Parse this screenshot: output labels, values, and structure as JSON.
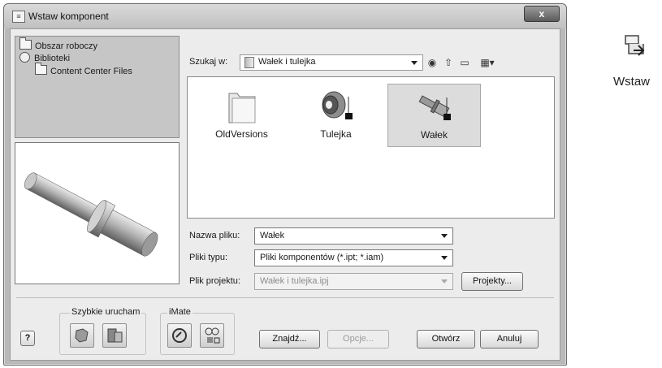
{
  "dialog": {
    "title": "Wstaw komponent",
    "close_label": "x"
  },
  "library_tree": {
    "items": [
      {
        "label": "Obszar roboczy",
        "icon": "workspace-folder-icon"
      },
      {
        "label": "Biblioteki",
        "icon": "libraries-icon"
      },
      {
        "label": "Content Center Files",
        "icon": "folder-icon"
      }
    ]
  },
  "browser": {
    "look_in_label": "Szukaj w:",
    "look_in_value": "Wałek i tulejka",
    "toolbar_icons": [
      "back-icon",
      "up-folder-icon",
      "new-folder-icon",
      "view-menu-icon"
    ],
    "files": [
      {
        "name": "OldVersions",
        "icon": "folder-icon",
        "selected": false
      },
      {
        "name": "Tulejka",
        "icon": "part-file-icon",
        "selected": false
      },
      {
        "name": "Wałek",
        "icon": "part-file-icon",
        "selected": true
      }
    ]
  },
  "form": {
    "filename_label": "Nazwa pliku:",
    "filename_value": "Wałek",
    "filetype_label": "Pliki typu:",
    "filetype_value": "Pliki komponentów (*.ipt; *.iam)",
    "project_label": "Plik projektu:",
    "project_value": "Wałek i tulejka.ipj",
    "projects_button": "Projekty..."
  },
  "bottom": {
    "help_label": "?",
    "quick_launch_label": "Szybkie urucham",
    "imate_label": "iMate",
    "find_button": "Znajdź...",
    "options_button": "Opcje...",
    "open_button": "Otwórz",
    "cancel_button": "Anuluj"
  },
  "ribbon_command": {
    "label": "Wstaw",
    "icon": "place-component-icon"
  }
}
